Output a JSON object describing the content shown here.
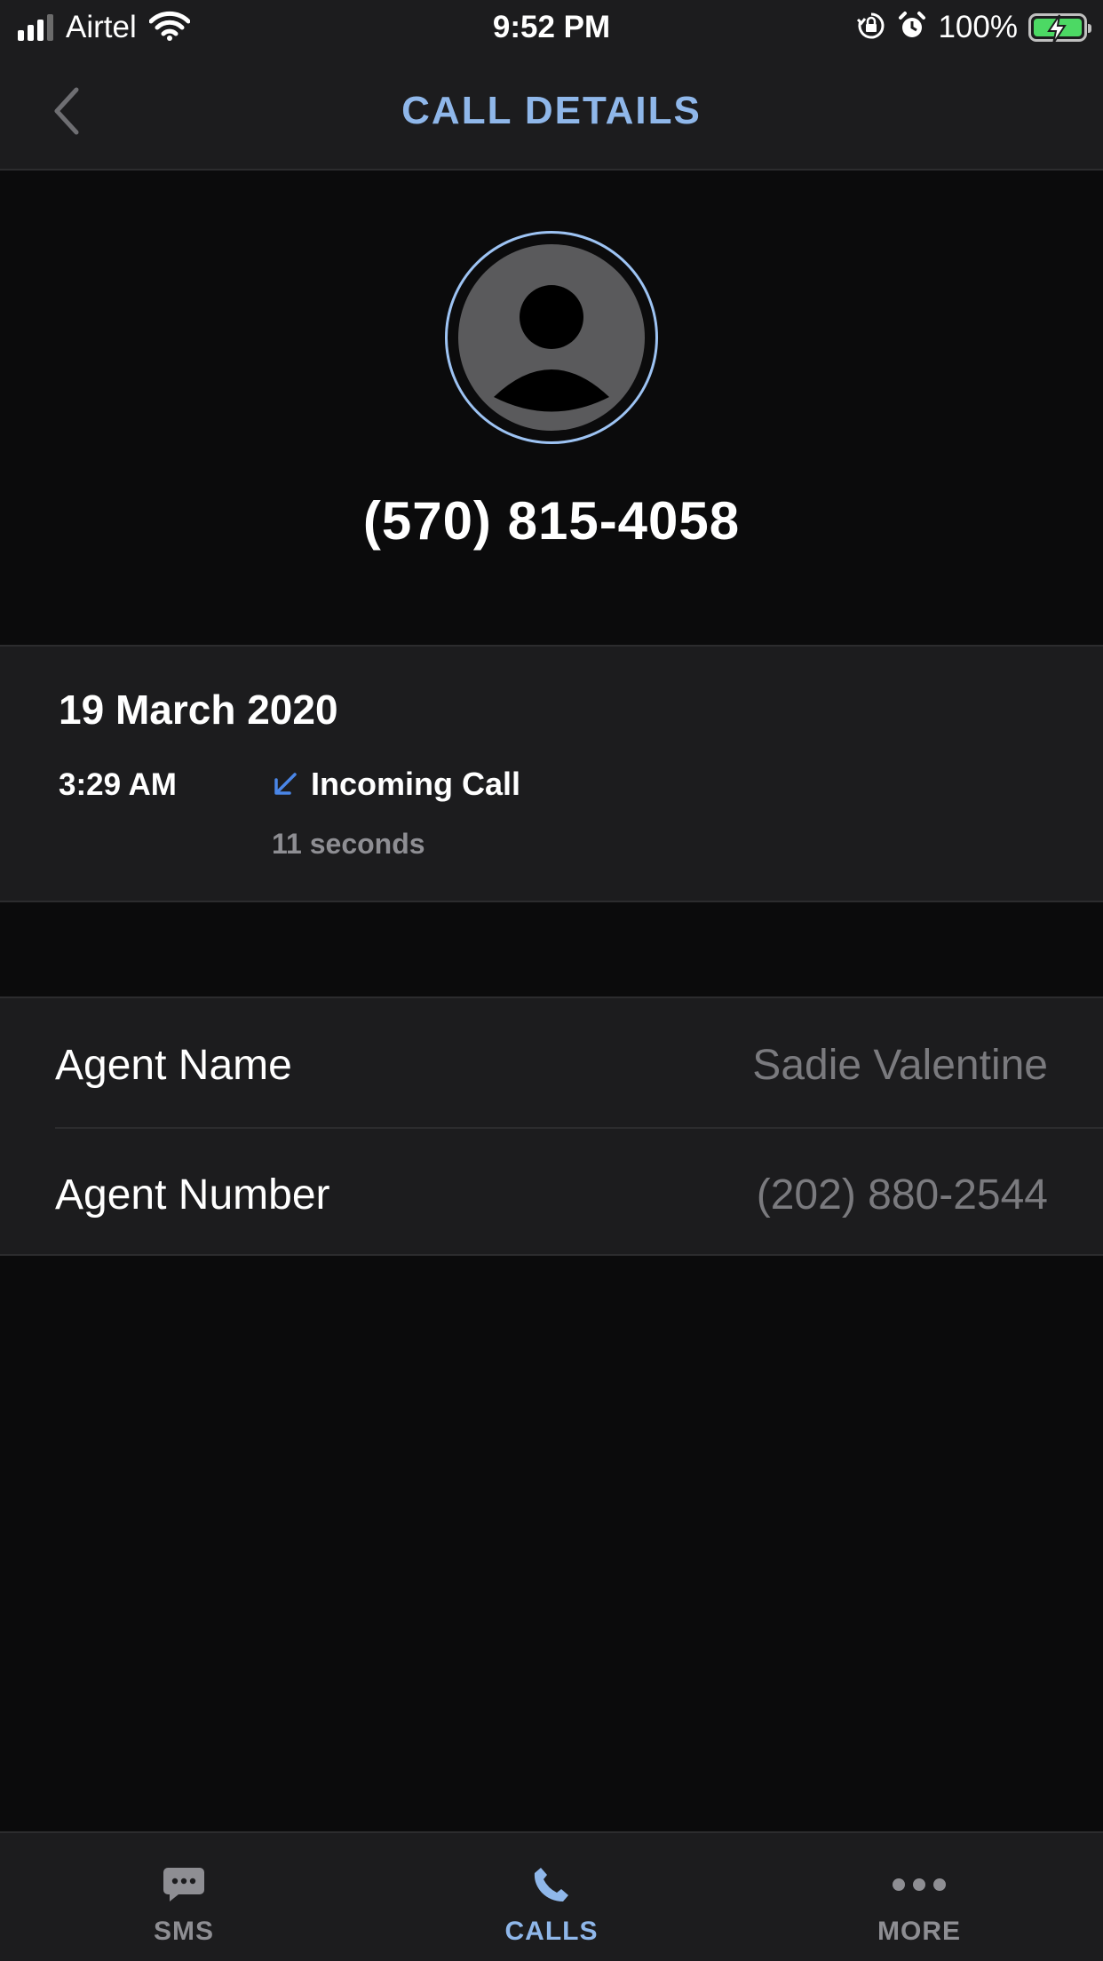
{
  "status_bar": {
    "carrier": "Airtel",
    "time": "9:52 PM",
    "battery_percent": "100%",
    "signal_bars": 3,
    "icons": [
      "signal-icon",
      "wifi-icon",
      "orientation-lock-icon",
      "alarm-icon",
      "battery-charging-icon"
    ]
  },
  "nav": {
    "title": "CALL DETAILS",
    "back_icon": "chevron-left-icon"
  },
  "contact": {
    "number": "(570) 815-4058",
    "avatar_icon": "person-icon"
  },
  "call": {
    "date": "19 March 2020",
    "time": "3:29 AM",
    "type": "Incoming Call",
    "type_icon": "incoming-arrow-icon",
    "duration": "11 seconds"
  },
  "agent": {
    "rows": [
      {
        "label": "Agent Name",
        "value": "Sadie Valentine"
      },
      {
        "label": "Agent Number",
        "value": "(202) 880-2544"
      }
    ]
  },
  "tabs": [
    {
      "label": "SMS",
      "icon": "message-bubble-icon",
      "active": false
    },
    {
      "label": "CALLS",
      "icon": "phone-icon",
      "active": true
    },
    {
      "label": "MORE",
      "icon": "ellipsis-icon",
      "active": false
    }
  ],
  "colors": {
    "accent": "#8fb7ea",
    "background": "#0b0b0c",
    "surface": "#1c1c1e",
    "secondary_text": "#8e8e93",
    "battery": "#4cd964",
    "incoming_arrow": "#4a86e8"
  }
}
